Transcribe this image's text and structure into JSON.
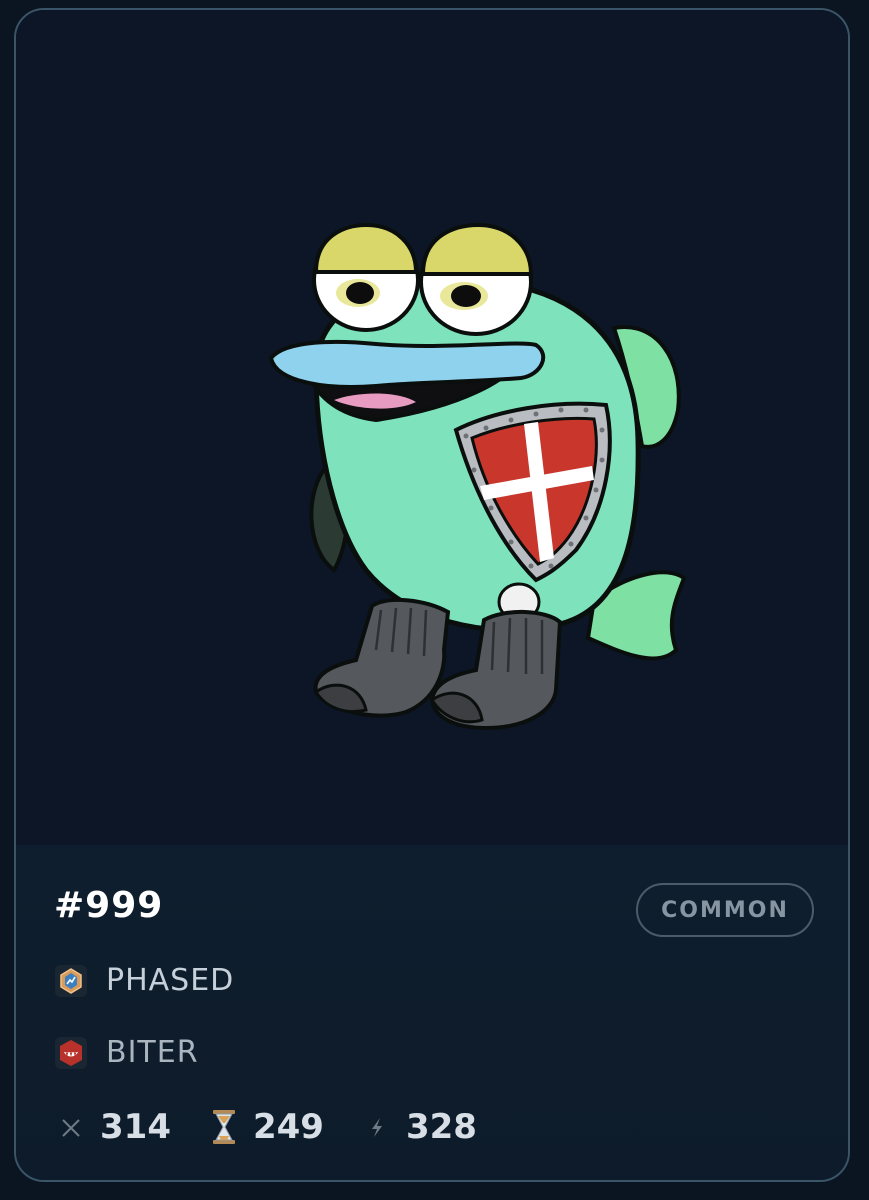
{
  "card": {
    "token_id": "#999",
    "rarity": "COMMON",
    "image_icon": "fish-with-shield-and-socks-illustration",
    "traits": [
      {
        "icon": "phased-hexagon-icon",
        "label": "PHASED"
      },
      {
        "icon": "biter-fangs-icon",
        "label": "BITER"
      }
    ],
    "stats": [
      {
        "icon": "crossed-swords-icon",
        "value": "314"
      },
      {
        "icon": "hourglass-icon",
        "value": "249"
      },
      {
        "icon": "lightning-icon",
        "value": "328"
      }
    ]
  },
  "colors": {
    "background": "#0c1626",
    "border": "#3a5568",
    "fish_body": "#7ee3bd",
    "shield_red": "#c8362c"
  }
}
